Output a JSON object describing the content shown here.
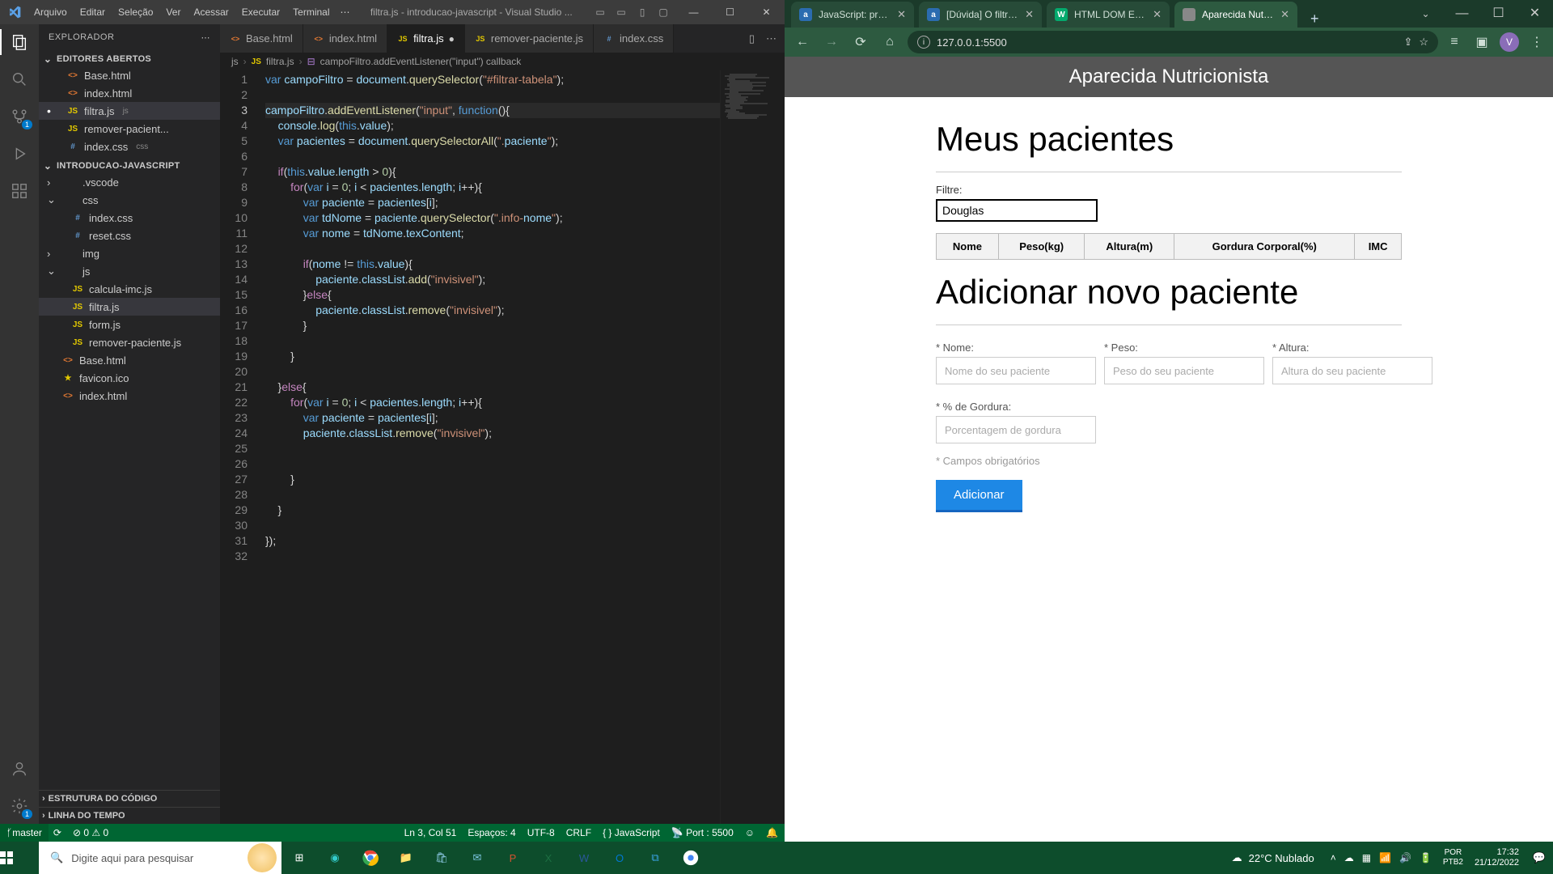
{
  "vscode": {
    "menus": [
      "Arquivo",
      "Editar",
      "Seleção",
      "Ver",
      "Acessar",
      "Executar",
      "Terminal"
    ],
    "menuMore": "⋯",
    "title": "filtra.js - introducao-javascript - Visual Studio ...",
    "explorer": {
      "title": "EXPLORADOR",
      "openEditors": "EDITORES ABERTOS",
      "project": "INTRODUCAO-JAVASCRIPT",
      "outline": "ESTRUTURA DO CÓDIGO",
      "timeline": "LINHA DO TEMPO",
      "open": [
        {
          "name": "Base.html",
          "ico": "html"
        },
        {
          "name": "index.html",
          "ico": "html"
        },
        {
          "name": "filtra.js",
          "ico": "js",
          "lang": "js",
          "active": true,
          "dirty": true
        },
        {
          "name": "remover-pacient...",
          "ico": "js"
        },
        {
          "name": "index.css",
          "ico": "css",
          "lang": "css"
        }
      ],
      "tree": [
        {
          "name": ".vscode",
          "ico": "folder",
          "chev": "›"
        },
        {
          "name": "css",
          "ico": "folder",
          "chev": "⌄"
        },
        {
          "name": "index.css",
          "ico": "css",
          "depth": 2
        },
        {
          "name": "reset.css",
          "ico": "css",
          "depth": 2
        },
        {
          "name": "img",
          "ico": "folder",
          "chev": "›"
        },
        {
          "name": "js",
          "ico": "folder",
          "chev": "⌄"
        },
        {
          "name": "calcula-imc.js",
          "ico": "js",
          "depth": 2
        },
        {
          "name": "filtra.js",
          "ico": "js",
          "depth": 2,
          "sel": true
        },
        {
          "name": "form.js",
          "ico": "js",
          "depth": 2
        },
        {
          "name": "remover-paciente.js",
          "ico": "js",
          "depth": 2
        },
        {
          "name": "Base.html",
          "ico": "html"
        },
        {
          "name": "favicon.ico",
          "ico": "fav"
        },
        {
          "name": "index.html",
          "ico": "html"
        }
      ]
    },
    "tabs": [
      {
        "name": "Base.html",
        "ico": "html"
      },
      {
        "name": "index.html",
        "ico": "html"
      },
      {
        "name": "filtra.js",
        "ico": "js",
        "active": true,
        "dirty": true
      },
      {
        "name": "remover-paciente.js",
        "ico": "js"
      },
      {
        "name": "index.css",
        "ico": "css"
      }
    ],
    "breadcrumb": [
      "js",
      "filtra.js",
      "campoFiltro.addEventListener(\"input\") callback"
    ],
    "code": [
      "var campoFiltro = document.querySelector(\"#filtrar-tabela\");",
      "",
      "campoFiltro.addEventListener(\"input\", function(){",
      "    console.log(this.value);",
      "    var pacientes = document.querySelectorAll(\".paciente\");",
      "",
      "    if(this.value.length > 0){",
      "        for(var i = 0; i < pacientes.length; i++){",
      "            var paciente = pacientes[i];",
      "            var tdNome = paciente.querySelector(\".info-nome\");",
      "            var nome = tdNome.texContent;",
      "",
      "            if(nome != this.value){",
      "                paciente.classList.add(\"invisivel\");",
      "            }else{",
      "                paciente.classList.remove(\"invisivel\");",
      "            }",
      "",
      "        }",
      "",
      "    }else{",
      "        for(var i = 0; i < pacientes.length; i++){",
      "            var paciente = pacientes[i];",
      "            paciente.classList.remove(\"invisivel\");",
      "",
      "",
      "        }",
      "",
      "    }",
      "",
      "});",
      ""
    ],
    "status": {
      "branch": "master",
      "sync": "⟳",
      "errors": "⊘ 0 ⚠ 0",
      "pos": "Ln 3, Col 51",
      "spaces": "Espaços: 4",
      "enc": "UTF-8",
      "eol": "CRLF",
      "lang": "JavaScript",
      "port": "Port : 5500"
    }
  },
  "chrome": {
    "tabs": [
      {
        "title": "JavaScript: program…",
        "favbg": "#2b6cb0",
        "favtxt": "a"
      },
      {
        "title": "[Dúvida] O filtro nã…",
        "favbg": "#2b6cb0",
        "favtxt": "a"
      },
      {
        "title": "HTML DOM Elemen…",
        "favbg": "#04aa6d",
        "favtxt": "W"
      },
      {
        "title": "Aparecida Nutrição",
        "favbg": "#888",
        "favtxt": "",
        "active": true
      }
    ],
    "url": "127.0.0.1:5500",
    "avatar": "V",
    "page": {
      "header": "Aparecida Nutricionista",
      "h2_patients": "Meus pacientes",
      "filter_label": "Filtre:",
      "filter_value": "Douglas",
      "th": [
        "Nome",
        "Peso(kg)",
        "Altura(m)",
        "Gordura Corporal(%)",
        "IMC"
      ],
      "h2_add": "Adicionar novo paciente",
      "labels": {
        "nome": "* Nome:",
        "peso": "* Peso:",
        "altura": "* Altura:",
        "gordura": "* % de Gordura:"
      },
      "ph": {
        "nome": "Nome do seu paciente",
        "peso": "Peso do seu paciente",
        "altura": "Altura do seu paciente",
        "gordura": "Porcentagem de gordura"
      },
      "required": "* Campos obrigatórios",
      "add_btn": "Adicionar"
    }
  },
  "taskbar": {
    "search_placeholder": "Digite aqui para pesquisar",
    "weather": "22°C  Nublado",
    "lang1": "POR",
    "lang2": "PTB2",
    "time": "17:32",
    "date": "21/12/2022"
  }
}
